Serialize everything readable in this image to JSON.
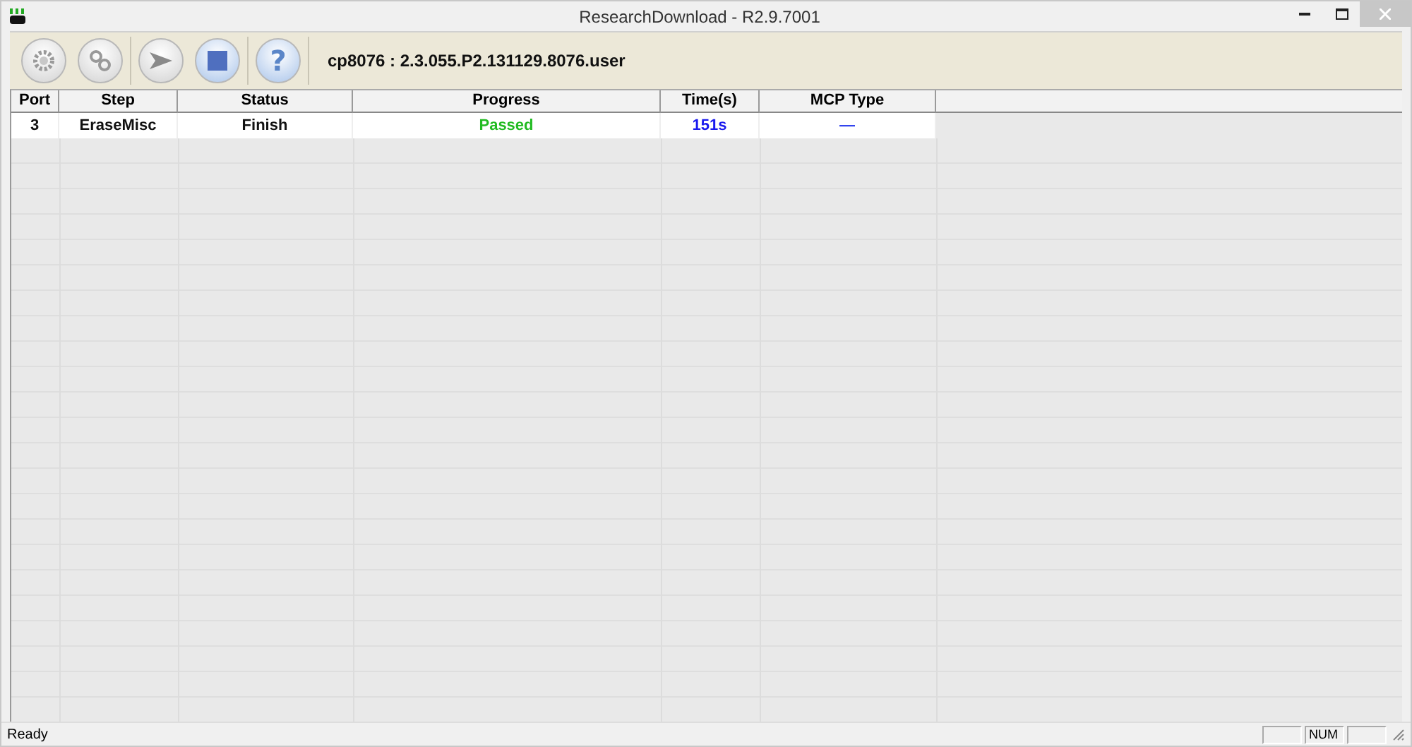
{
  "window": {
    "title": "ResearchDownload - R2.9.7001"
  },
  "toolbar": {
    "buttons": [
      {
        "kind": "settings",
        "disabled": true
      },
      {
        "kind": "gears",
        "disabled": true
      },
      {
        "kind": "start",
        "disabled": true
      },
      {
        "kind": "stop",
        "disabled": false
      },
      {
        "kind": "help",
        "label": "?",
        "disabled": false
      }
    ],
    "version": "cp8076 : 2.3.055.P2.131129.8076.user"
  },
  "table": {
    "columns": [
      "Port",
      "Step",
      "Status",
      "Progress",
      "Time(s)",
      "MCP Type"
    ],
    "rows": [
      {
        "port": "3",
        "step": "EraseMisc",
        "status": "Finish",
        "progress": "Passed",
        "time": "151s",
        "mcp_type": "—"
      }
    ]
  },
  "status_bar": {
    "text": "Ready",
    "indicators": [
      "NUM"
    ]
  }
}
